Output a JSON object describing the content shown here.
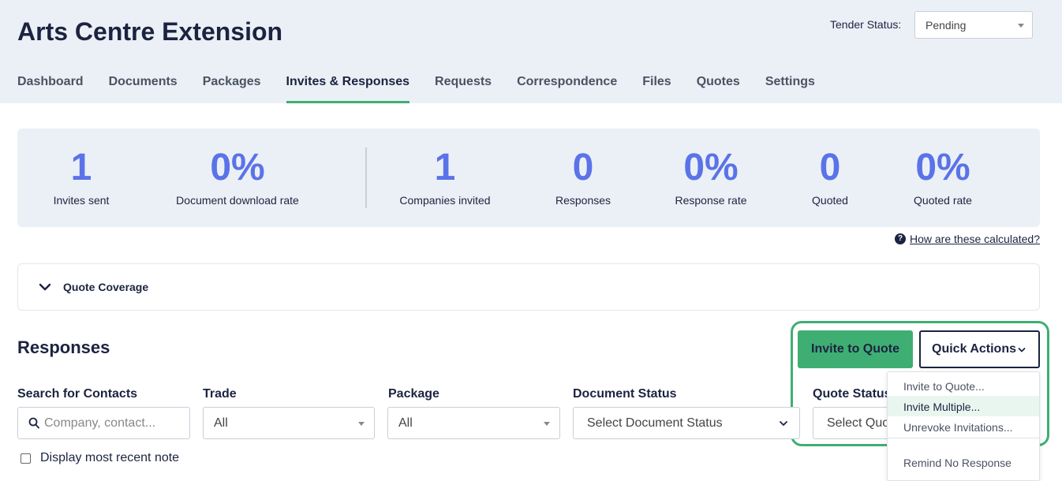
{
  "project": {
    "title": "Arts Centre Extension"
  },
  "tender": {
    "label": "Tender Status:",
    "value": "Pending"
  },
  "tabs": [
    {
      "label": "Dashboard"
    },
    {
      "label": "Documents"
    },
    {
      "label": "Packages"
    },
    {
      "label": "Invites & Responses",
      "active": true
    },
    {
      "label": "Requests"
    },
    {
      "label": "Correspondence"
    },
    {
      "label": "Files"
    },
    {
      "label": "Quotes"
    },
    {
      "label": "Settings"
    }
  ],
  "stats": [
    {
      "value": "1",
      "label": "Invites sent"
    },
    {
      "value": "0%",
      "label": "Document download rate"
    },
    {
      "value": "1",
      "label": "Companies invited"
    },
    {
      "value": "0",
      "label": "Responses"
    },
    {
      "value": "0%",
      "label": "Response rate"
    },
    {
      "value": "0",
      "label": "Quoted"
    },
    {
      "value": "0%",
      "label": "Quoted rate"
    }
  ],
  "help_link": "How are these calculated?",
  "coverage": {
    "label": "Quote Coverage"
  },
  "responses": {
    "title": "Responses",
    "invite_button": "Invite to Quote",
    "quick_actions_button": "Quick Actions",
    "quick_actions_menu": [
      "Invite to Quote...",
      "Invite Multiple...",
      "Unrevoke Invitations...",
      "Remind No Response"
    ],
    "quick_actions_highlighted": "Invite Multiple...",
    "filters": {
      "search": {
        "label": "Search for Contacts",
        "placeholder": "Company, contact..."
      },
      "trade": {
        "label": "Trade",
        "value": "All"
      },
      "package": {
        "label": "Package",
        "value": "All"
      },
      "document_status": {
        "label": "Document Status",
        "value": "Select Document Status"
      },
      "quote_status": {
        "label": "Quote Status",
        "value": "Select Quote Status"
      }
    },
    "note_checkbox": {
      "label": "Display most recent note",
      "checked": false
    }
  },
  "colors": {
    "accent": "#3fae72",
    "stat_value": "#5b73e8",
    "text": "#1c2340",
    "header_bg": "#ebf0f6"
  },
  "icons": [
    "chevron-down-icon",
    "search-icon",
    "help-icon"
  ]
}
